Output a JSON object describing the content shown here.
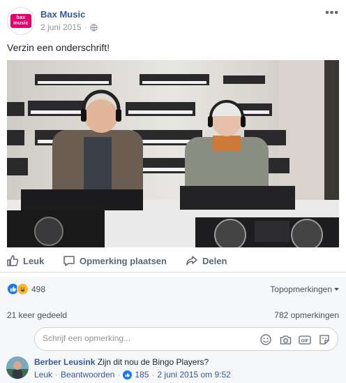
{
  "post": {
    "page_name": "Bax Music",
    "avatar_text_top": "bax",
    "avatar_text_bottom": "music",
    "date": "2 juni 2015",
    "separator": "·",
    "more_label": "•••",
    "caption": "Verzin een onderschrift!"
  },
  "actions": {
    "like": "Leuk",
    "comment": "Opmerking plaatsen",
    "share": "Delen"
  },
  "reactions": {
    "count": "498",
    "top_comments": "Topopmerkingen",
    "icons": [
      "like-icon",
      "haha-icon"
    ]
  },
  "stats": {
    "shared": "21 keer gedeeld",
    "comments": "782 opmerkingen"
  },
  "composer": {
    "placeholder": "Schrijf een opmerking...",
    "icons": [
      "emoji-icon",
      "camera-icon",
      "gif-icon",
      "sticker-icon"
    ],
    "gif_text": "GIF"
  },
  "comment": {
    "author": "Berber Leusink",
    "text": "Zijn dit nou de Bingo Players?",
    "like_link": "Leuk",
    "reply_link": "Beantwoorden",
    "like_count": "185",
    "timestamp": "2 juni 2015 om 9:52",
    "dot": "·"
  },
  "colors": {
    "brand": "#e5006e",
    "link": "#365899",
    "facebook_blue": "#1877f2"
  }
}
